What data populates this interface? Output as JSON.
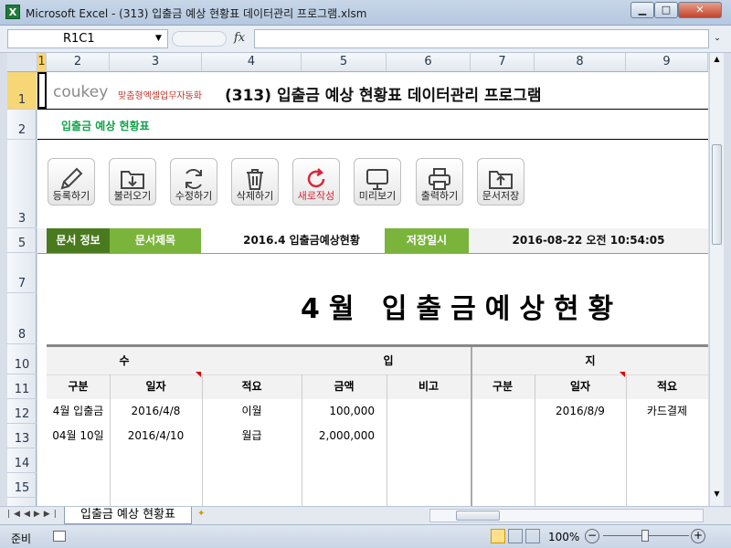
{
  "window": {
    "title": "Microsoft Excel - (313) 입출금 예상 현황표 데이터관리 프로그램.xlsm",
    "app_icon": "excel-icon"
  },
  "formula_bar": {
    "name_box": "R1C1",
    "fx": "fx",
    "value": ""
  },
  "columns": [
    "1",
    "2",
    "3",
    "4",
    "5",
    "6",
    "7",
    "8",
    "9"
  ],
  "rows": [
    "1",
    "2",
    "3",
    "5",
    "7",
    "8",
    "10",
    "11",
    "12",
    "13",
    "14",
    "15"
  ],
  "header": {
    "logo_main": "coukey",
    "logo_sub": "맞춤형엑셀업무자동화",
    "title": "(313) 입출금 예상 현황표 데이터관리 프로그램",
    "subtitle": "입출금 예상 현황표"
  },
  "toolbar": [
    {
      "label": "등록하기",
      "icon": "pencil-icon"
    },
    {
      "label": "불러오기",
      "icon": "folder-download-icon"
    },
    {
      "label": "수정하기",
      "icon": "refresh-icon"
    },
    {
      "label": "삭제하기",
      "icon": "trash-icon"
    },
    {
      "label": "새로작성",
      "icon": "new-refresh-icon"
    },
    {
      "label": "미리보기",
      "icon": "monitor-icon"
    },
    {
      "label": "출력하기",
      "icon": "printer-icon"
    },
    {
      "label": "문서저장",
      "icon": "folder-upload-icon"
    }
  ],
  "info": {
    "doc_info_label": "문서 정보",
    "doc_title_label": "문서제목",
    "doc_title_value": "2016.4 입출금예상현황",
    "saved_label": "저장일시",
    "saved_value": "2016-08-22 오전 10:54:05"
  },
  "report_title": "4월 입출금예상현황",
  "table": {
    "income_label": "수",
    "income_label2": "입",
    "expense_label": "지",
    "columns": [
      "구분",
      "일자",
      "적요",
      "금액",
      "비고",
      "구분",
      "일자",
      "적요"
    ],
    "rows": [
      [
        "4월 입출금",
        "2016/4/8",
        "이월",
        "100,000",
        "",
        "",
        "2016/8/9",
        "카드결제"
      ],
      [
        "04월 10일",
        "2016/4/10",
        "월급",
        "2,000,000",
        "",
        "",
        "",
        ""
      ]
    ]
  },
  "sheet_tabs": {
    "active": "입출금 예상 현황표"
  },
  "status": {
    "mode": "준비",
    "zoom": "100%"
  },
  "colors": {
    "accent_green": "#7ab43a",
    "dark_green": "#4a7a1e",
    "title_green": "#12a34a"
  }
}
